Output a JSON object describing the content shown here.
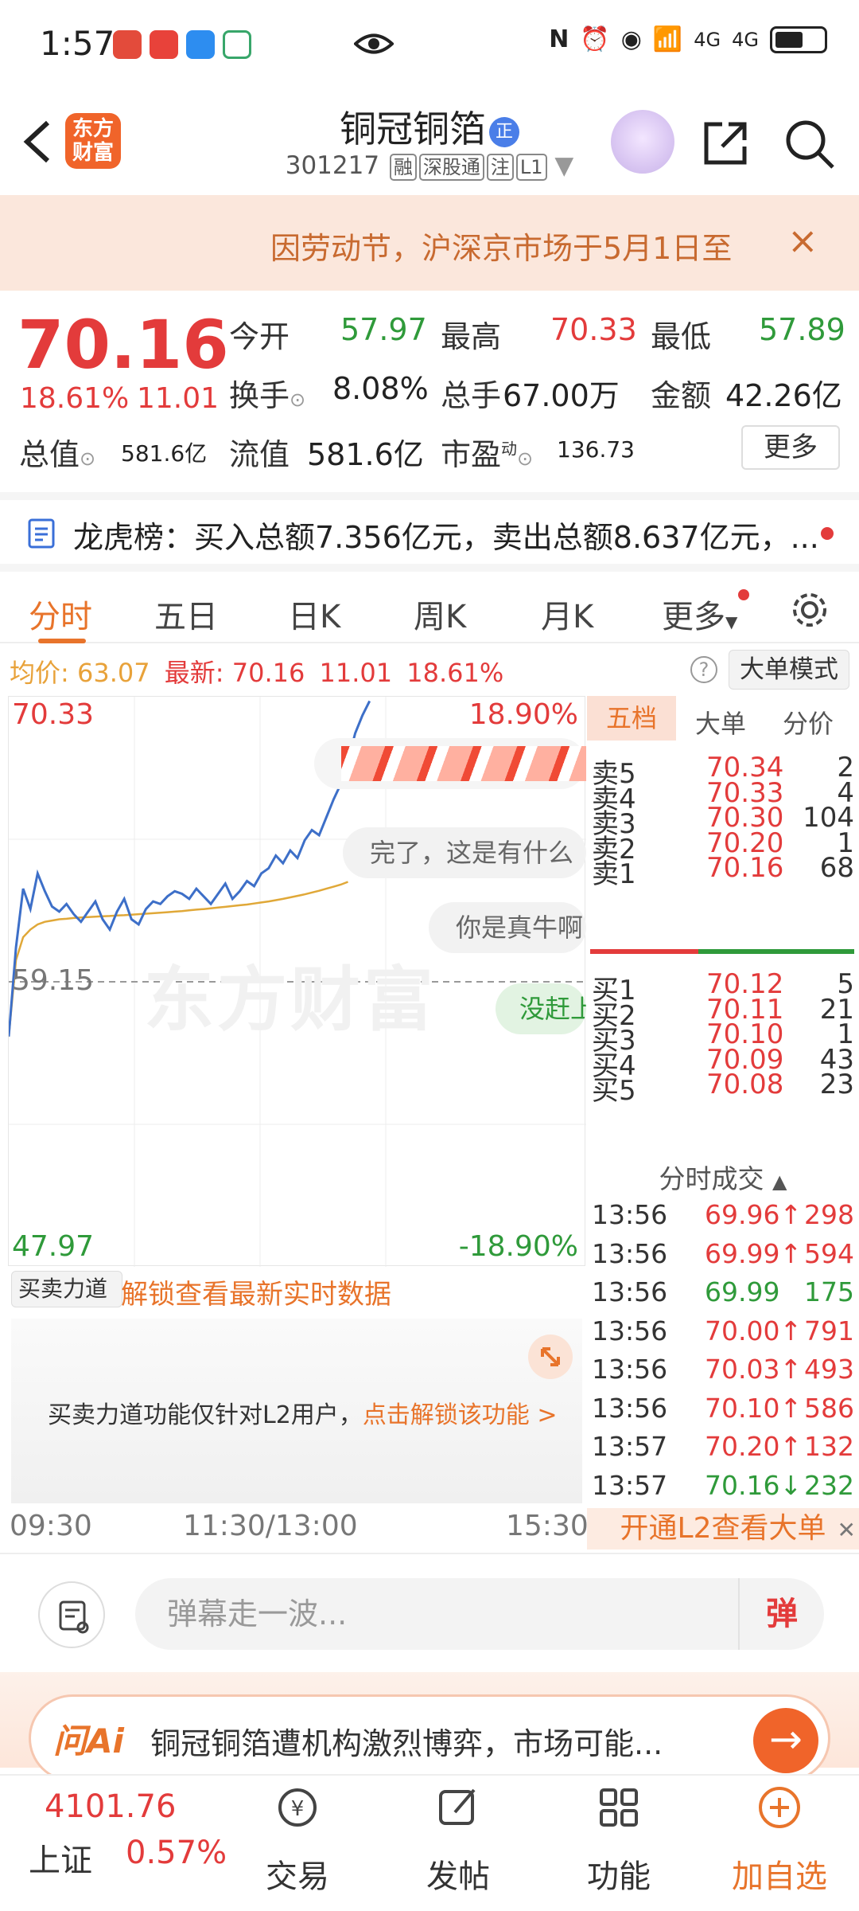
{
  "status": {
    "time": "1:57",
    "net1": "4G",
    "net2": "4G"
  },
  "header": {
    "logo": "东方财富",
    "name": "铜冠铜箔",
    "badge": "正",
    "code": "301217",
    "tags": [
      "融",
      "深股通",
      "注",
      "L1"
    ]
  },
  "notice": {
    "text": "因劳动节，沪深京市场于5月1日至",
    "close": "×"
  },
  "quote": {
    "price": "70.16",
    "pct": "18.61%",
    "change": "11.01",
    "open_label": "今开",
    "open": "57.97",
    "high_label": "最高",
    "high": "70.33",
    "low_label": "最低",
    "low": "57.89",
    "turnover_label": "换手",
    "turnover": "8.08%",
    "volume_label": "总手",
    "volume": "67.00万",
    "amount_label": "金额",
    "amount": "42.26亿",
    "mcap_label": "总值",
    "mcap": "581.6亿",
    "float_label": "流值",
    "float": "581.6亿",
    "pe_label": "市盈",
    "pe_sup": "动",
    "pe": "136.73",
    "more": "更多"
  },
  "lhb": {
    "text": "龙虎榜：买入总额7.356亿元，卖出总额8.637亿元，..."
  },
  "tabs": [
    "分时",
    "五日",
    "日K",
    "周K",
    "月K",
    "更多"
  ],
  "avg": {
    "avg_label": "均价:",
    "avg": "63.07",
    "last_label": "最新:",
    "last": "70.16",
    "chg": "11.01",
    "pct": "18.61%"
  },
  "mode_button": "大单模式",
  "chart": {
    "top_price": "70.33",
    "top_pct": "18.90%",
    "mid_price": "59.15",
    "bottom_price": "47.97",
    "bottom_pct": "-18.90%",
    "watermark": "东方财富",
    "danmu": [
      "完了，这是有什么",
      "你是真牛啊",
      "没赶上"
    ],
    "price_series": [
      57.0,
      60.5,
      62.8,
      62.0,
      63.4,
      62.7,
      62.1,
      61.9,
      62.2,
      61.8,
      61.5,
      61.9,
      62.3,
      61.6,
      61.2,
      61.9,
      62.4,
      61.6,
      61.4,
      62.0,
      62.3,
      62.2,
      62.5,
      62.7,
      62.6,
      62.4,
      62.8,
      62.5,
      62.2,
      62.6,
      63.0,
      62.4,
      62.7,
      63.1,
      62.9,
      63.4,
      63.6,
      64.1,
      63.8,
      64.3,
      64.0,
      64.7,
      65.1,
      64.9,
      65.6,
      66.3,
      66.9,
      67.8,
      68.9,
      69.6,
      70.16
    ],
    "avg_series": [
      57.0,
      60.0,
      60.9,
      61.2,
      61.4,
      61.5,
      61.55,
      61.6,
      61.62,
      61.65,
      61.67,
      61.69,
      61.7,
      61.72,
      61.73,
      61.75,
      61.76,
      61.78,
      61.8,
      61.82,
      61.84,
      61.86,
      61.88,
      61.9,
      61.92,
      61.95,
      61.98,
      62.0,
      62.03,
      62.06,
      62.09,
      62.12,
      62.15,
      62.18,
      62.22,
      62.26,
      62.3,
      62.35,
      62.4,
      62.46,
      62.52,
      62.58,
      62.65,
      62.72,
      62.8,
      62.88,
      62.96,
      63.07
    ]
  },
  "buysell": {
    "button": "买卖力道",
    "unlock": "解锁查看最新实时数据",
    "msg": "买卖力道功能仅针对L2用户，",
    "link": "点击解锁该功能 >"
  },
  "time_axis": [
    "09:30",
    "11:30/13:00",
    "15:30"
  ],
  "book": {
    "tabs": [
      "五档",
      "大单",
      "分价"
    ],
    "asks": [
      {
        "l": "卖5",
        "p": "70.34",
        "v": "2"
      },
      {
        "l": "卖4",
        "p": "70.33",
        "v": "4"
      },
      {
        "l": "卖3",
        "p": "70.30",
        "v": "104"
      },
      {
        "l": "卖2",
        "p": "70.20",
        "v": "1"
      },
      {
        "l": "卖1",
        "p": "70.16",
        "v": "68"
      }
    ],
    "bids": [
      {
        "l": "买1",
        "p": "70.12",
        "v": "5"
      },
      {
        "l": "买2",
        "p": "70.11",
        "v": "21"
      },
      {
        "l": "买3",
        "p": "70.10",
        "v": "1"
      },
      {
        "l": "买4",
        "p": "70.09",
        "v": "43"
      },
      {
        "l": "买5",
        "p": "70.08",
        "v": "23"
      }
    ],
    "deal_title": "分时成交",
    "trades": [
      {
        "t": "13:56",
        "p": "69.96↑",
        "v": "298",
        "c": "red"
      },
      {
        "t": "13:56",
        "p": "69.99↑",
        "v": "594",
        "c": "red"
      },
      {
        "t": "13:56",
        "p": "69.99",
        "v": "175",
        "c": "green"
      },
      {
        "t": "13:56",
        "p": "70.00↑",
        "v": "791",
        "c": "red"
      },
      {
        "t": "13:56",
        "p": "70.03↑",
        "v": "493",
        "c": "red"
      },
      {
        "t": "13:56",
        "p": "70.10↑",
        "v": "586",
        "c": "red"
      },
      {
        "t": "13:57",
        "p": "70.20↑",
        "v": "132",
        "c": "red"
      },
      {
        "t": "13:57",
        "p": "70.16↓",
        "v": "232",
        "c": "green"
      }
    ],
    "l2": "开通L2查看大单"
  },
  "input": {
    "placeholder": "弹幕走一波...",
    "dan": "弹"
  },
  "ai": {
    "logo": "问Ai",
    "text": "铜冠铜箔遭机构激烈博弈，市场可能..."
  },
  "bottom": {
    "index_value": "4101.76",
    "index_name": "上证",
    "index_pct": "0.57%",
    "nav": [
      "交易",
      "发帖",
      "功能",
      "加自选"
    ]
  },
  "colors": {
    "red": "#e33b3b",
    "green": "#2f9a3a",
    "accent": "#e8742b"
  }
}
